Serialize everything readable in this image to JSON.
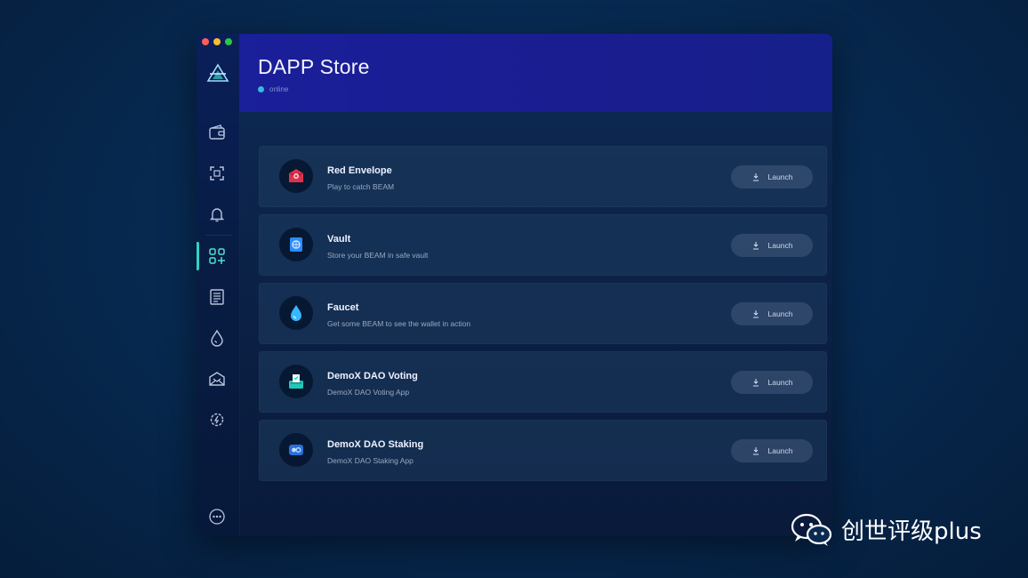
{
  "app": {
    "title": "DAPP Store",
    "subtitle": "online"
  },
  "sidebar": {
    "items": [
      {
        "icon": "wallet-icon"
      },
      {
        "icon": "scan-icon"
      },
      {
        "icon": "bell-icon"
      },
      {
        "icon": "apps-grid-icon",
        "active": true
      },
      {
        "icon": "document-icon"
      },
      {
        "icon": "drop-icon"
      },
      {
        "icon": "envelope-icon"
      },
      {
        "icon": "settings-icon"
      },
      {
        "icon": "more-icon"
      }
    ],
    "active_color": "#2fd3c8"
  },
  "dapps": [
    {
      "name": "Red Envelope",
      "description": "Play to catch BEAM",
      "button": "Launch",
      "icon": "red-envelope-icon"
    },
    {
      "name": "Vault",
      "description": "Store your BEAM in safe vault",
      "button": "Launch",
      "icon": "vault-icon"
    },
    {
      "name": "Faucet",
      "description": "Get some BEAM to see the wallet in action",
      "button": "Launch",
      "icon": "faucet-icon"
    },
    {
      "name": "DemoX DAO Voting",
      "description": "DemoX DAO Voting App",
      "button": "Launch",
      "icon": "dao-voting-icon"
    },
    {
      "name": "DemoX DAO Staking",
      "description": "DemoX DAO Staking App",
      "button": "Launch",
      "icon": "dao-staking-icon"
    }
  ],
  "watermark": {
    "text": "创世评级plus",
    "icon": "wechat-icon"
  },
  "colors": {
    "header": "#1a1f9a",
    "accent": "#2fd3c8",
    "red_envelope": "#e0314b",
    "vault": "#2a8cff",
    "faucet": "#38b6ff",
    "dao_voting": "#22c7b8",
    "dao_staking": "#2c6fd9"
  }
}
